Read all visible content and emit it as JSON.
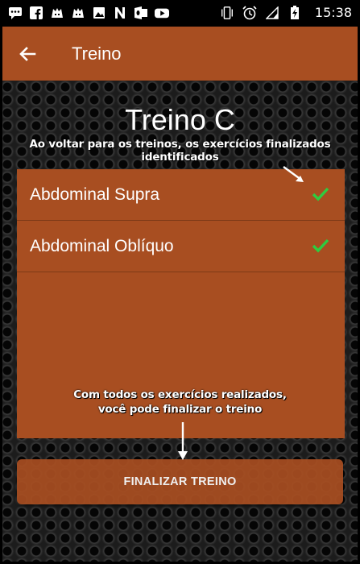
{
  "status_bar": {
    "time": "15:38",
    "left_icons": [
      "chat-icon",
      "facebook-icon",
      "game-icon",
      "game-icon",
      "image-icon",
      "n-icon",
      "outlook-icon",
      "youtube-icon"
    ],
    "right_icons": [
      "vibrate-icon",
      "alarm-icon",
      "signal-icon",
      "battery-charging-icon"
    ]
  },
  "app_bar": {
    "title": "Treino",
    "color": "#a84e21"
  },
  "main": {
    "workout_title": "Treino C",
    "note_top": "Ao voltar para os treinos, os exercícios finalizados identificados",
    "note_bottom_line1": "Com todos os exercícios realizados,",
    "note_bottom_line2": "você pode finalizar o treino",
    "exercises": [
      {
        "label": "Abdominal Supra",
        "done": true
      },
      {
        "label": "Abdominal Oblíquo",
        "done": true
      }
    ],
    "finish_button": "FINALIZAR TREINO",
    "check_color": "#2ecc40"
  }
}
